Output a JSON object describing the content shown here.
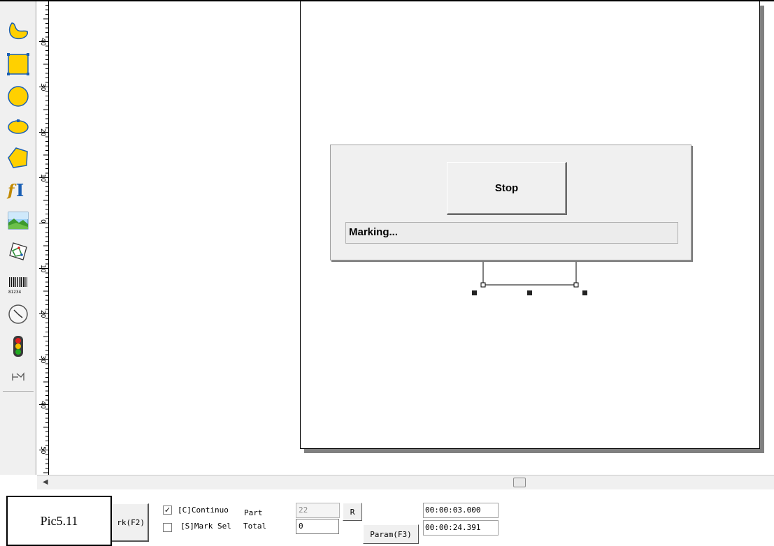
{
  "ruler": {
    "labels": [
      "40",
      "30",
      "20",
      "10",
      "0",
      "10",
      "20",
      "30",
      "40",
      "50"
    ]
  },
  "toolbar": {
    "tools": [
      {
        "name": "curve-tool",
        "icon": "curve-icon"
      },
      {
        "name": "rectangle-tool",
        "icon": "rectangle-icon"
      },
      {
        "name": "circle-tool",
        "icon": "circle-icon"
      },
      {
        "name": "ellipse-tool",
        "icon": "ellipse-icon"
      },
      {
        "name": "polygon-tool",
        "icon": "polygon-icon"
      },
      {
        "name": "text-tool",
        "icon": "text-icon"
      },
      {
        "name": "bitmap-tool",
        "icon": "image-icon"
      },
      {
        "name": "vector-file-tool",
        "icon": "vector-file-icon"
      },
      {
        "name": "barcode-tool",
        "icon": "barcode-icon"
      },
      {
        "name": "delay-tool",
        "icon": "clock-icon"
      },
      {
        "name": "io-signal-tool",
        "icon": "traffic-light-icon"
      },
      {
        "name": "motion-tool",
        "icon": "motion-icon"
      }
    ],
    "barcode_digits": "81234",
    "colors": {
      "shape_fill": "#ffd000",
      "shape_stroke": "#1a5fb4"
    }
  },
  "dialog": {
    "stop_label": "Stop",
    "status_text": "Marking..."
  },
  "bottom": {
    "mark_button_label": "rk(F2)",
    "continuous": {
      "label": "[C]Continuo",
      "checked": true
    },
    "mark_selected": {
      "label": "[S]Mark Sel",
      "checked": false
    },
    "part_label": "Part",
    "part_value": "22",
    "total_label": "Total",
    "total_value": "0",
    "reset_label": "R",
    "param_label": "Param(F3)",
    "time_current": "00:00:03.000",
    "time_total": "00:00:24.391"
  },
  "caption": "Pic5.11"
}
